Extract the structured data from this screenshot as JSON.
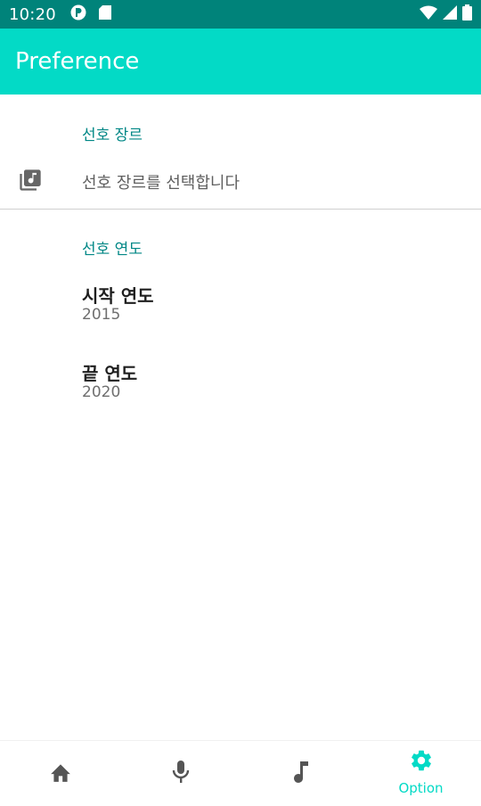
{
  "status_bar": {
    "time": "10:20",
    "icons": [
      "notification-app-icon",
      "sd-card-icon",
      "wifi-icon",
      "signal-icon",
      "battery-icon"
    ]
  },
  "app_bar": {
    "title": "Preference"
  },
  "genre_section": {
    "category": "선호 장르",
    "item_label": "선호 장르를 선택합니다",
    "icon": "library-music-icon"
  },
  "year_section": {
    "category": "선호 연도",
    "start": {
      "title": "시작 연도",
      "value": "2015"
    },
    "end": {
      "title": "끝 연도",
      "value": "2020"
    }
  },
  "bottom_nav": {
    "items": [
      {
        "icon": "home-icon",
        "label": ""
      },
      {
        "icon": "mic-icon",
        "label": ""
      },
      {
        "icon": "music-note-icon",
        "label": ""
      },
      {
        "icon": "gear-icon",
        "label": "Option",
        "active": true
      }
    ]
  },
  "colors": {
    "primary": "#03dac6",
    "status_bar": "#00837a",
    "accent_text": "#018786"
  }
}
